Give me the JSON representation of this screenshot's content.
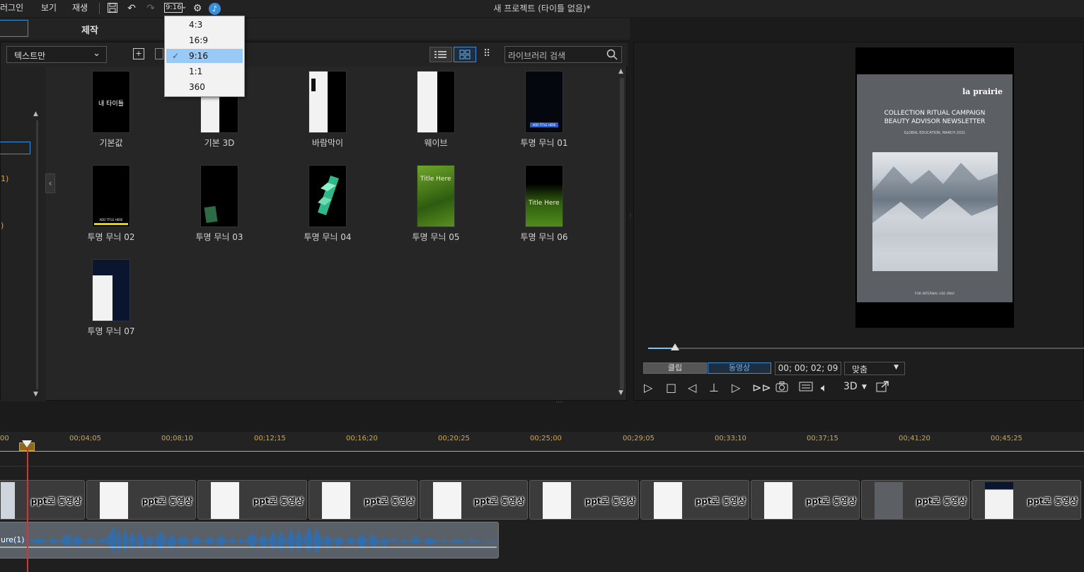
{
  "menubar": {
    "items": [
      "러그인",
      "보기",
      "재생"
    ],
    "aspect_label": "9:16",
    "title": "새 프로젝트 (타이틀 없음)*"
  },
  "aspect_menu": {
    "options": [
      "4:3",
      "16:9",
      "9:16",
      "1:1",
      "360"
    ],
    "selected": "9:16",
    "check": "✓"
  },
  "tabs": {
    "produce": "제작"
  },
  "library": {
    "filter_value": "텍스트만",
    "search_placeholder": "라이브러리 검색",
    "sidebar_frags": [
      "1)",
      ")"
    ],
    "items": [
      {
        "label": "기본값",
        "thumb_text": "내 타이틀"
      },
      {
        "label": "기본 3D",
        "thumb_text": ""
      },
      {
        "label": "바람막이",
        "thumb_text": ""
      },
      {
        "label": "웨이브",
        "thumb_text": ""
      },
      {
        "label": "투명 무늬 01",
        "thumb_text": "ADD TITLE HERE"
      },
      {
        "label": "투명 무늬 02",
        "thumb_text": "ADD TITLE HERE"
      },
      {
        "label": "투명 무늬 03",
        "thumb_text": ""
      },
      {
        "label": "투명 무늬 04",
        "thumb_text": ""
      },
      {
        "label": "투명 무늬 05",
        "thumb_text": "Title Here"
      },
      {
        "label": "투명 무늬 06",
        "thumb_text": "Title Here"
      },
      {
        "label": "투명 무늬 07",
        "thumb_text": ""
      }
    ]
  },
  "preview": {
    "brand": "la prairie",
    "headline1": "COLLECTION RITUAL CAMPAIGN",
    "headline2": "BEAUTY ADVISOR NEWSLETTER",
    "subline": "GLOBAL  EDUCATION,  MARCH  2021",
    "footer": "FOR INTERNAL USE ONLY",
    "clip_tab": "클립",
    "video_tab": "동영상",
    "timecode": "00; 00; 02; 09",
    "fit": "맞춤",
    "mode_3d": "3D"
  },
  "timeline": {
    "ticks": [
      "00",
      "00;04;05",
      "00;08;10",
      "00;12;15",
      "00;16;20",
      "00;20;25",
      "00;25;00",
      "00;29;05",
      "00;33;10",
      "00;37;15",
      "00;41;20",
      "00;45;25"
    ],
    "clip_label": "ppt로 동영상",
    "audio_label": "ure(1)"
  },
  "colors": {
    "accent": "#3b8ed8",
    "selection": "#99c9f5",
    "ruler": "#d4a640",
    "playhead": "#e03030"
  }
}
